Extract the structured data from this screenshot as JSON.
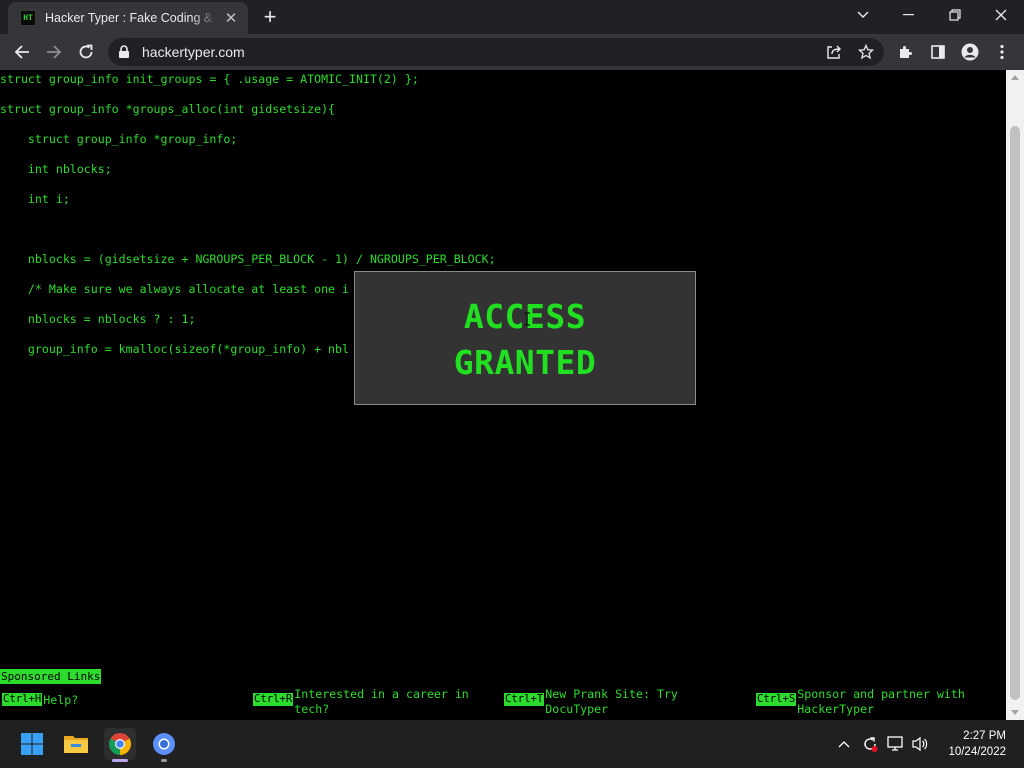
{
  "browser": {
    "tab_title": "Hacker Typer : Fake Coding & Hacker Simulator",
    "favicon_text": "HT",
    "url": "hackertyper.com"
  },
  "code_lines": [
    "struct group_info init_groups = { .usage = ATOMIC_INIT(2) };",
    "struct group_info *groups_alloc(int gidsetsize){",
    "    struct group_info *group_info;",
    "    int nblocks;",
    "    int i;",
    "",
    "    nblocks = (gidsetsize + NGROUPS_PER_BLOCK - 1) / NGROUPS_PER_BLOCK;",
    "    /* Make sure we always allocate at least one i",
    "    nblocks = nblocks ? : 1;",
    "    group_info = kmalloc(sizeof(*group_info) + nbl"
  ],
  "popup": {
    "line1": "ACCESS",
    "line2": "GRANTED"
  },
  "footer": {
    "sponsored": "Sponsored Links",
    "hints": [
      {
        "key": "Ctrl+H",
        "label": "Help?"
      },
      {
        "key": "Ctrl+R",
        "label": "Interested in a career in tech?"
      },
      {
        "key": "Ctrl+T",
        "label": "New Prank Site: Try DocuTyper"
      },
      {
        "key": "Ctrl+S",
        "label": "Sponsor and partner with HackerTyper"
      }
    ]
  },
  "taskbar": {
    "time": "2:27 PM",
    "date": "10/24/2022"
  },
  "colors": {
    "terminal_green": "#2cdb2c",
    "popup_bg": "#333333",
    "chrome_dark": "#202124",
    "chrome_toolbar": "#35363a"
  },
  "icons": {
    "back": "arrow-left-icon",
    "forward": "arrow-right-icon",
    "reload": "reload-icon",
    "lock": "lock-icon",
    "share": "share-icon",
    "bookmark": "star-icon",
    "extensions": "puzzle-icon",
    "side_panel": "side-panel-icon",
    "profile": "profile-icon",
    "menu": "kebab-menu-icon"
  }
}
